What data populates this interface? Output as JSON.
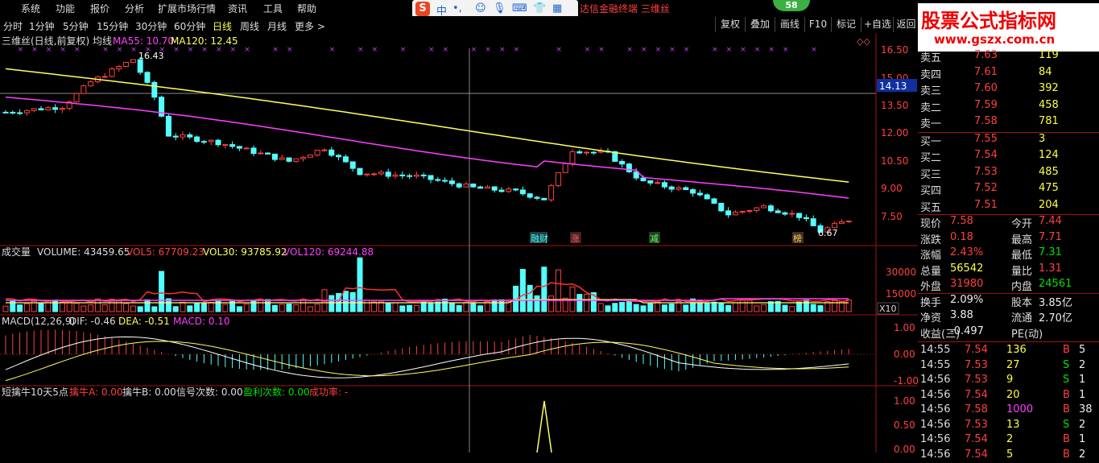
{
  "menu": [
    "系统",
    "功能",
    "报价",
    "分析",
    "扩展市场行情",
    "资讯",
    "工具",
    "帮助"
  ],
  "title_tail": "达信金融终端  三维丝",
  "ime": {
    "label": "中"
  },
  "badge": "58",
  "periods": [
    "分时",
    "1分钟",
    "5分钟",
    "15分钟",
    "30分钟",
    "60分钟",
    "日线",
    "周线",
    "月线",
    "更多 >"
  ],
  "active_period": "日线",
  "toolbar": [
    "复权",
    "叠加",
    "画线",
    "F10",
    "标记",
    "+自选",
    "返回"
  ],
  "watermark": {
    "line1": "股票公式指标网",
    "line2": "www.gszx.com.cn"
  },
  "main_chart": {
    "title": "三维丝(日线,前复权) 均线",
    "ma55_label": "MA55: 10.70",
    "ma120_label": "MA120: 12.45",
    "high_label": "16.43",
    "low_label": "6.67",
    "cursor_price": "14.13",
    "y_ticks": [
      "16.50",
      "15.00",
      "13.50",
      "12.00",
      "10.50",
      "9.00",
      "7.50"
    ],
    "events": [
      "融财",
      "涨",
      "减",
      "榜"
    ]
  },
  "volume": {
    "title": "成交量",
    "volume": "VOLUME: 43459.65",
    "vol5": "VOL5: 67709.23",
    "vol30": "VOL30: 93785.92",
    "vol120": "VOL120: 69244.88",
    "y_ticks": [
      "30000",
      "15000"
    ],
    "unit": "X10"
  },
  "macd": {
    "title": "MACD(12,26,9)",
    "dif": "DIF: -0.46",
    "dea": "DEA: -0.51",
    "macd": "MACD: 0.10",
    "y_ticks": [
      "1.00",
      "0.00",
      "-1.00"
    ]
  },
  "indicator": {
    "title": "短擒牛10天5点",
    "a": "擒牛A: 0.00",
    "b": "擒牛B: 0.00",
    "signals": "信号次数: 0.00",
    "wins": "盈利次数: 0.00",
    "rate": "成功率: -",
    "y_ticks": [
      "1.00",
      "0.50",
      "0.00"
    ]
  },
  "quote": {
    "asks": [
      {
        "label": "卖五",
        "price": "7.63",
        "vol": "119"
      },
      {
        "label": "卖四",
        "price": "7.61",
        "vol": "84"
      },
      {
        "label": "卖三",
        "price": "7.60",
        "vol": "392"
      },
      {
        "label": "卖二",
        "price": "7.59",
        "vol": "458"
      },
      {
        "label": "卖一",
        "price": "7.58",
        "vol": "781"
      }
    ],
    "bids": [
      {
        "label": "买一",
        "price": "7.55",
        "vol": "3"
      },
      {
        "label": "买二",
        "price": "7.54",
        "vol": "124"
      },
      {
        "label": "买三",
        "price": "7.53",
        "vol": "485"
      },
      {
        "label": "买四",
        "price": "7.52",
        "vol": "475"
      },
      {
        "label": "买五",
        "price": "7.51",
        "vol": "204"
      }
    ],
    "stats": [
      {
        "l1": "现价",
        "v1": "7.58",
        "c1": "red",
        "l2": "今开",
        "v2": "7.44",
        "c2": "red"
      },
      {
        "l1": "涨跌",
        "v1": "0.18",
        "c1": "red",
        "l2": "最高",
        "v2": "7.71",
        "c2": "red"
      },
      {
        "l1": "涨幅",
        "v1": "2.43%",
        "c1": "red",
        "l2": "最低",
        "v2": "7.31",
        "c2": "grn"
      },
      {
        "l1": "总量",
        "v1": "56542",
        "c1": "yel",
        "l2": "量比",
        "v2": "1.31",
        "c2": "red"
      },
      {
        "l1": "外盘",
        "v1": "31980",
        "c1": "red",
        "l2": "内盘",
        "v2": "24561",
        "c2": "grn"
      },
      {
        "l1": "换手",
        "v1": "2.09%",
        "c1": "wht",
        "l2": "股本",
        "v2": "3.85亿",
        "c2": "wht"
      },
      {
        "l1": "净资",
        "v1": "3.88",
        "c1": "wht",
        "l2": "流通",
        "v2": "2.70亿",
        "c2": "wht"
      },
      {
        "l1": "收益(三)",
        "v1": "-0.497",
        "c1": "wht",
        "l2": "PE(动)",
        "v2": "",
        "c2": "wht"
      }
    ],
    "ticks": [
      {
        "t": "14:55",
        "p": "7.54",
        "v": "136",
        "s": "B",
        "n": "5"
      },
      {
        "t": "14:55",
        "p": "7.53",
        "v": "27",
        "s": "S",
        "n": "2"
      },
      {
        "t": "14:56",
        "p": "7.53",
        "v": "9",
        "s": "S",
        "n": "1"
      },
      {
        "t": "14:56",
        "p": "7.54",
        "v": "20",
        "s": "B",
        "n": "1"
      },
      {
        "t": "14:56",
        "p": "7.58",
        "v": "1000",
        "s": "B",
        "n": "38"
      },
      {
        "t": "14:56",
        "p": "7.53",
        "v": "13",
        "s": "S",
        "n": "2"
      },
      {
        "t": "14:56",
        "p": "7.54",
        "v": "2",
        "s": "B",
        "n": "1"
      },
      {
        "t": "14:56",
        "p": "7.54",
        "v": "5",
        "s": "B",
        "n": "2"
      }
    ]
  }
}
